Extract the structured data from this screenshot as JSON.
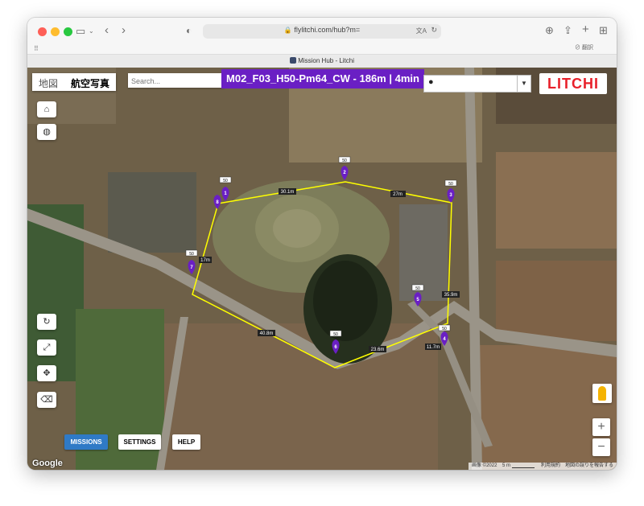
{
  "browser": {
    "url": "flylitchi.com/hub?m=",
    "tab_title": "Mission Hub - Litchi",
    "translate_label": "翻訳"
  },
  "map": {
    "map_type_options": [
      "地図",
      "航空写真"
    ],
    "search_placeholder": "Search...",
    "mission_title": "M02_F03_H50-Pm64_CW - 186m | 4min",
    "logo_text": "LITCHI",
    "waypoints": [
      {
        "id": "1",
        "altitude": "50"
      },
      {
        "id": "2",
        "altitude": "50"
      },
      {
        "id": "3",
        "altitude": "50"
      },
      {
        "id": "4",
        "altitude": "50"
      },
      {
        "id": "5",
        "altitude": "50"
      },
      {
        "id": "6",
        "altitude": "50"
      },
      {
        "id": "7",
        "altitude": "50"
      },
      {
        "id": "8",
        "altitude": "50"
      }
    ],
    "segments": [
      "30.1m",
      "27m",
      "35.9m",
      "11.7m",
      "23.6m",
      "40.8m",
      "17m"
    ],
    "tabs": {
      "missions": "MISSIONS",
      "settings": "SETTINGS",
      "help": "HELP"
    },
    "google_logo": "Google",
    "footer": {
      "imagery": "画像 ©2022",
      "scale": "5 m",
      "terms": "利用規約",
      "report": "地図の誤りを報告する"
    },
    "zoom_in": "+",
    "zoom_out": "−"
  },
  "colors": {
    "mission_title_bg": "#6a1fc4",
    "path_line": "#ffff00",
    "waypoint_marker": "#6a1fc4",
    "missions_button": "#2f7ac6",
    "logo_red": "#e8202a"
  }
}
